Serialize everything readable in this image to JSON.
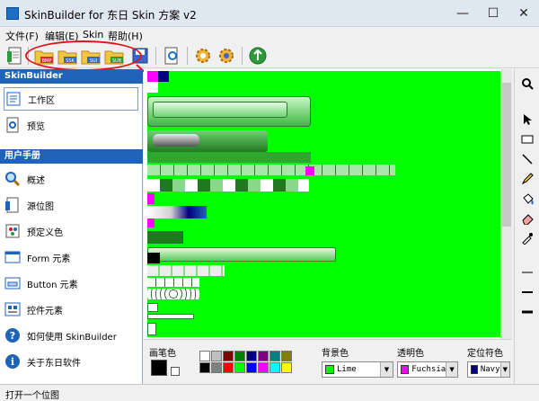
{
  "window": {
    "title": "SkinBuilder for 东日 Skin 方案 v2",
    "min": "—",
    "max": "☐",
    "close": "✕"
  },
  "menu": [
    "文件(F)",
    "编辑(E)",
    "Skin",
    "帮助(H)"
  ],
  "toolbar": {
    "badges": [
      "BMP",
      "SSK",
      "SUI",
      "SUB"
    ]
  },
  "sidebar": {
    "section1": "SkinBuilder",
    "workspace": "工作区",
    "preview": "预览",
    "section2": "用户手册",
    "items": [
      "概述",
      "源位图",
      "预定义色",
      "Form 元素",
      "Button 元素",
      "控件元素",
      "如何使用 SkinBuilder",
      "关于东日软件"
    ]
  },
  "bottom": {
    "pen_label": "画笔色",
    "bg_label": "背景色",
    "bg_value": "Lime",
    "bg_color": "#00ff00",
    "trans_label": "透明色",
    "trans_value": "Fuchsia",
    "trans_color": "#ff00ff",
    "anchor_label": "定位符色",
    "anchor_value": "Navy",
    "anchor_color": "#000080",
    "palette": [
      "#ffffff",
      "#000000",
      "#c0c0c0",
      "#808080",
      "#800000",
      "#ff0000",
      "#008000",
      "#00ff00",
      "#000080",
      "#0000ff",
      "#800080",
      "#ff00ff",
      "#008080",
      "#00ffff",
      "#808000",
      "#ffff00"
    ]
  },
  "status": "打开一个位图",
  "colors": {
    "accent": "#1f64b8",
    "canvas": "#00ff00",
    "highlight": "#e0141a"
  }
}
